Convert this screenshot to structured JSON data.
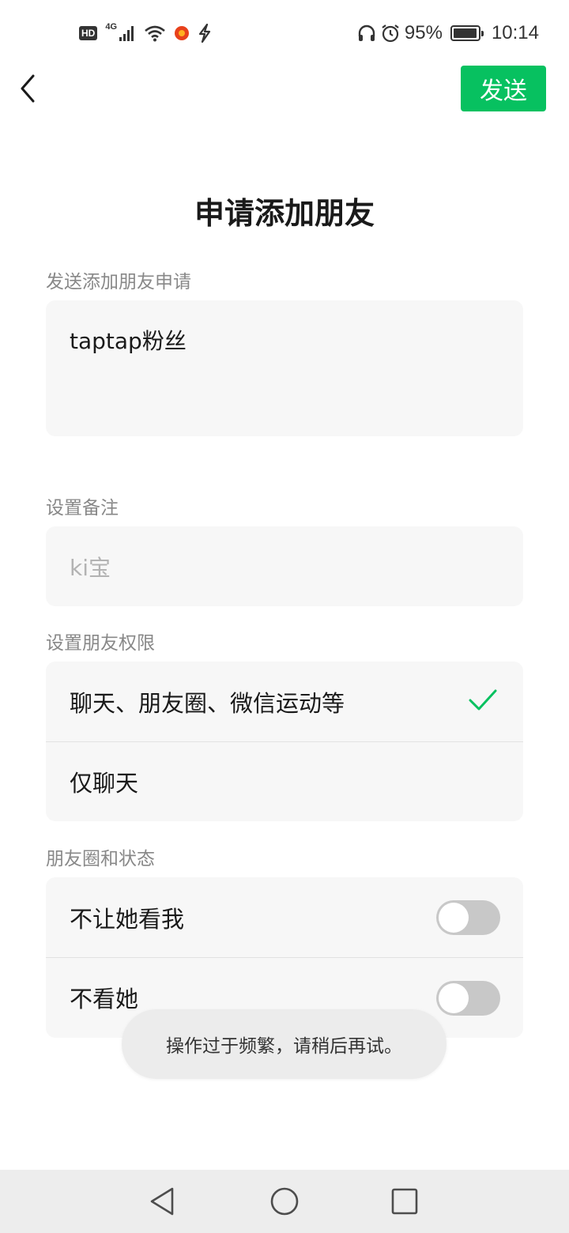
{
  "status_bar": {
    "hd": "HD",
    "network": "4G",
    "battery_text": "95%",
    "battery_level": 0.95,
    "time": "10:14",
    "icons": [
      "signal-icon",
      "wifi-icon",
      "app-notification-icon",
      "flash-app-icon",
      "headphones-icon",
      "alarm-icon",
      "battery-icon"
    ]
  },
  "header": {
    "back_icon": "back-chevron-icon",
    "send_label": "发送",
    "accent_color": "#07c160"
  },
  "page_title": "申请添加朋友",
  "request": {
    "label": "发送添加朋友申请",
    "message": "taptap粉丝"
  },
  "remark": {
    "label": "设置备注",
    "placeholder": "ki宝"
  },
  "permissions": {
    "label": "设置朋友权限",
    "options": [
      {
        "label": "聊天、朋友圈、微信运动等",
        "selected": true
      },
      {
        "label": "仅聊天",
        "selected": false
      }
    ]
  },
  "moments": {
    "label": "朋友圈和状态",
    "toggles": [
      {
        "label": "不让她看我",
        "on": false
      },
      {
        "label": "不看她",
        "on": false
      }
    ]
  },
  "toast": "操作过于频繁，请稍后再试。",
  "navbar": {
    "icons": [
      "nav-back-icon",
      "nav-home-icon",
      "nav-recents-icon"
    ]
  }
}
